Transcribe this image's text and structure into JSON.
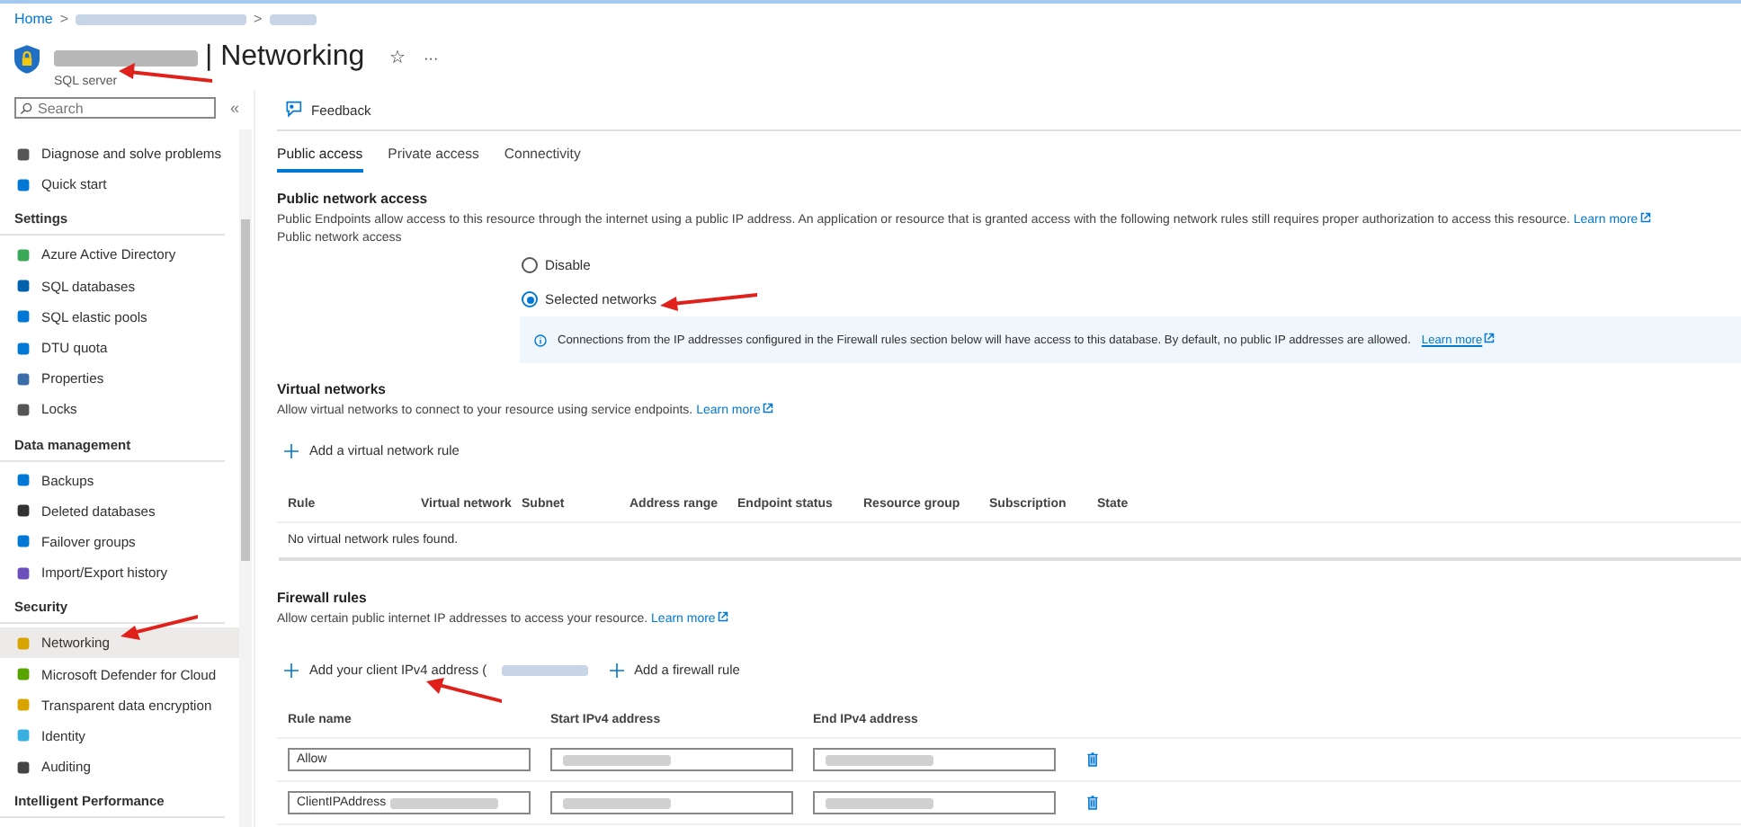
{
  "breadcrumb": {
    "home": "Home",
    "separator": ">"
  },
  "header": {
    "title": "| Networking",
    "subtitle": "SQL server",
    "star": "☆",
    "more": "···"
  },
  "sidebar": {
    "search": {
      "placeholder": "Search"
    },
    "collapse": "«",
    "groups": [
      {
        "items": [
          {
            "label": "Diagnose and solve problems",
            "selected": false
          },
          {
            "label": "Quick start",
            "selected": false
          }
        ]
      },
      {
        "heading": "Settings",
        "items": [
          {
            "label": "Azure Active Directory",
            "selected": false
          },
          {
            "label": "SQL databases",
            "selected": false
          },
          {
            "label": "SQL elastic pools",
            "selected": false
          },
          {
            "label": "DTU quota",
            "selected": false
          },
          {
            "label": "Properties",
            "selected": false
          },
          {
            "label": "Locks",
            "selected": false
          }
        ]
      },
      {
        "heading": "Data management",
        "items": [
          {
            "label": "Backups",
            "selected": false
          },
          {
            "label": "Deleted databases",
            "selected": false
          },
          {
            "label": "Failover groups",
            "selected": false
          },
          {
            "label": "Import/Export history",
            "selected": false
          }
        ]
      },
      {
        "heading": "Security",
        "items": [
          {
            "label": "Networking",
            "selected": true
          },
          {
            "label": "Microsoft Defender for Cloud",
            "selected": false
          },
          {
            "label": "Transparent data encryption",
            "selected": false
          },
          {
            "label": "Identity",
            "selected": false
          },
          {
            "label": "Auditing",
            "selected": false
          }
        ]
      },
      {
        "heading": "Intelligent Performance"
      }
    ]
  },
  "toolbar": {
    "feedback": "Feedback"
  },
  "tabs": [
    {
      "label": "Public access",
      "selected": true
    },
    {
      "label": "Private access",
      "selected": false
    },
    {
      "label": "Connectivity",
      "selected": false
    }
  ],
  "public_access": {
    "heading": "Public network access",
    "description": "Public Endpoints allow access to this resource through the internet using a public IP address. An application or resource that is granted access with the following network rules still requires proper authorization to access this resource.",
    "learn_more": "Learn more",
    "field_label": "Public network access",
    "options": [
      {
        "label": "Disable",
        "selected": false
      },
      {
        "label": "Selected networks",
        "selected": true
      }
    ],
    "info": "Connections from the IP addresses configured in the Firewall rules section below will have access to this database. By default, no public IP addresses are allowed.",
    "info_link": "Learn more"
  },
  "virtual_networks": {
    "heading": "Virtual networks",
    "description": "Allow virtual networks to connect to your resource using service endpoints.",
    "learn_more": "Learn more",
    "add": "Add a virtual network rule",
    "columns": [
      "Rule",
      "Virtual network",
      "Subnet",
      "Address range",
      "Endpoint status",
      "Resource group",
      "Subscription",
      "State"
    ],
    "empty": "No virtual network rules found."
  },
  "firewall": {
    "heading": "Firewall rules",
    "description": "Allow certain public internet IP addresses to access your resource.",
    "learn_more": "Learn more",
    "add_client": "Add your client IPv4 address (",
    "add_rule": "Add a firewall rule",
    "columns": [
      "Rule name",
      "Start IPv4 address",
      "End IPv4 address"
    ],
    "rows": [
      {
        "rule_name": "Allow",
        "name_redacted": false
      },
      {
        "rule_name": "ClientIPAddress",
        "name_redacted": true
      }
    ]
  }
}
